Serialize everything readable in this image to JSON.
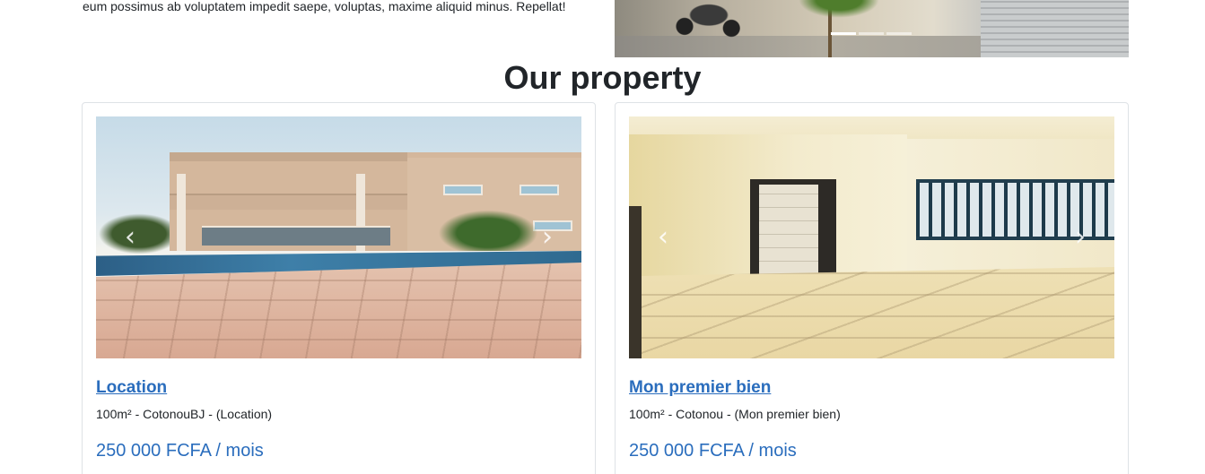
{
  "intro": {
    "text": "eum possimus ab voluptatem impedit saepe, voluptas, maxime aliquid minus. Repellat!"
  },
  "hero": {
    "indicator_count": 3,
    "active_indicator": 0
  },
  "section": {
    "title": "Our property"
  },
  "properties": [
    {
      "title": "Location",
      "meta": "100m² - CotonouBJ - (Location)",
      "price": "250 000 FCFA / mois",
      "prev_icon": "‹",
      "next_icon": "›"
    },
    {
      "title": "Mon premier bien",
      "meta": "100m² - Cotonou - (Mon premier bien)",
      "price": "250 000 FCFA / mois",
      "prev_icon": "‹",
      "next_icon": "›"
    }
  ],
  "colors": {
    "link": "#2a6dbd",
    "text": "#212529",
    "border": "#dee2e6"
  }
}
